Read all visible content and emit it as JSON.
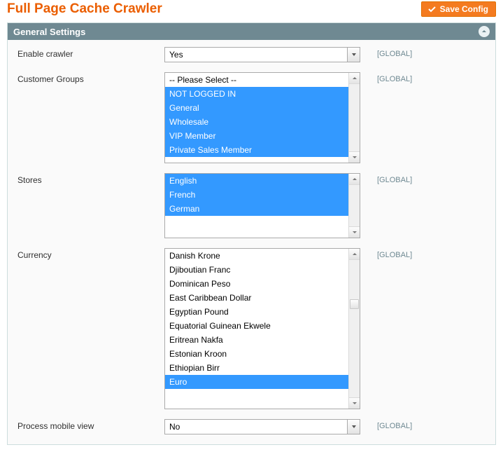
{
  "page": {
    "title": "Full Page Cache Crawler",
    "save_label": "Save Config"
  },
  "panel": {
    "title": "General Settings"
  },
  "scope_label": "[GLOBAL]",
  "fields": {
    "enable_crawler": {
      "label": "Enable crawler",
      "value": "Yes"
    },
    "customer_groups": {
      "label": "Customer Groups",
      "placeholder": "-- Please Select --",
      "options": [
        "NOT LOGGED IN",
        "General",
        "Wholesale",
        "VIP Member",
        "Private Sales Member"
      ],
      "selected": [
        "NOT LOGGED IN",
        "General",
        "Wholesale",
        "VIP Member",
        "Private Sales Member"
      ]
    },
    "stores": {
      "label": "Stores",
      "options": [
        "English",
        "French",
        "German"
      ],
      "selected": [
        "English",
        "French",
        "German"
      ]
    },
    "currency": {
      "label": "Currency",
      "visible_options": [
        "Danish Krone",
        "Djiboutian Franc",
        "Dominican Peso",
        "East Caribbean Dollar",
        "Egyptian Pound",
        "Equatorial Guinean Ekwele",
        "Eritrean Nakfa",
        "Estonian Kroon",
        "Ethiopian Birr",
        "Euro"
      ],
      "selected": [
        "Euro"
      ]
    },
    "process_mobile": {
      "label": "Process mobile view",
      "value": "No"
    }
  }
}
